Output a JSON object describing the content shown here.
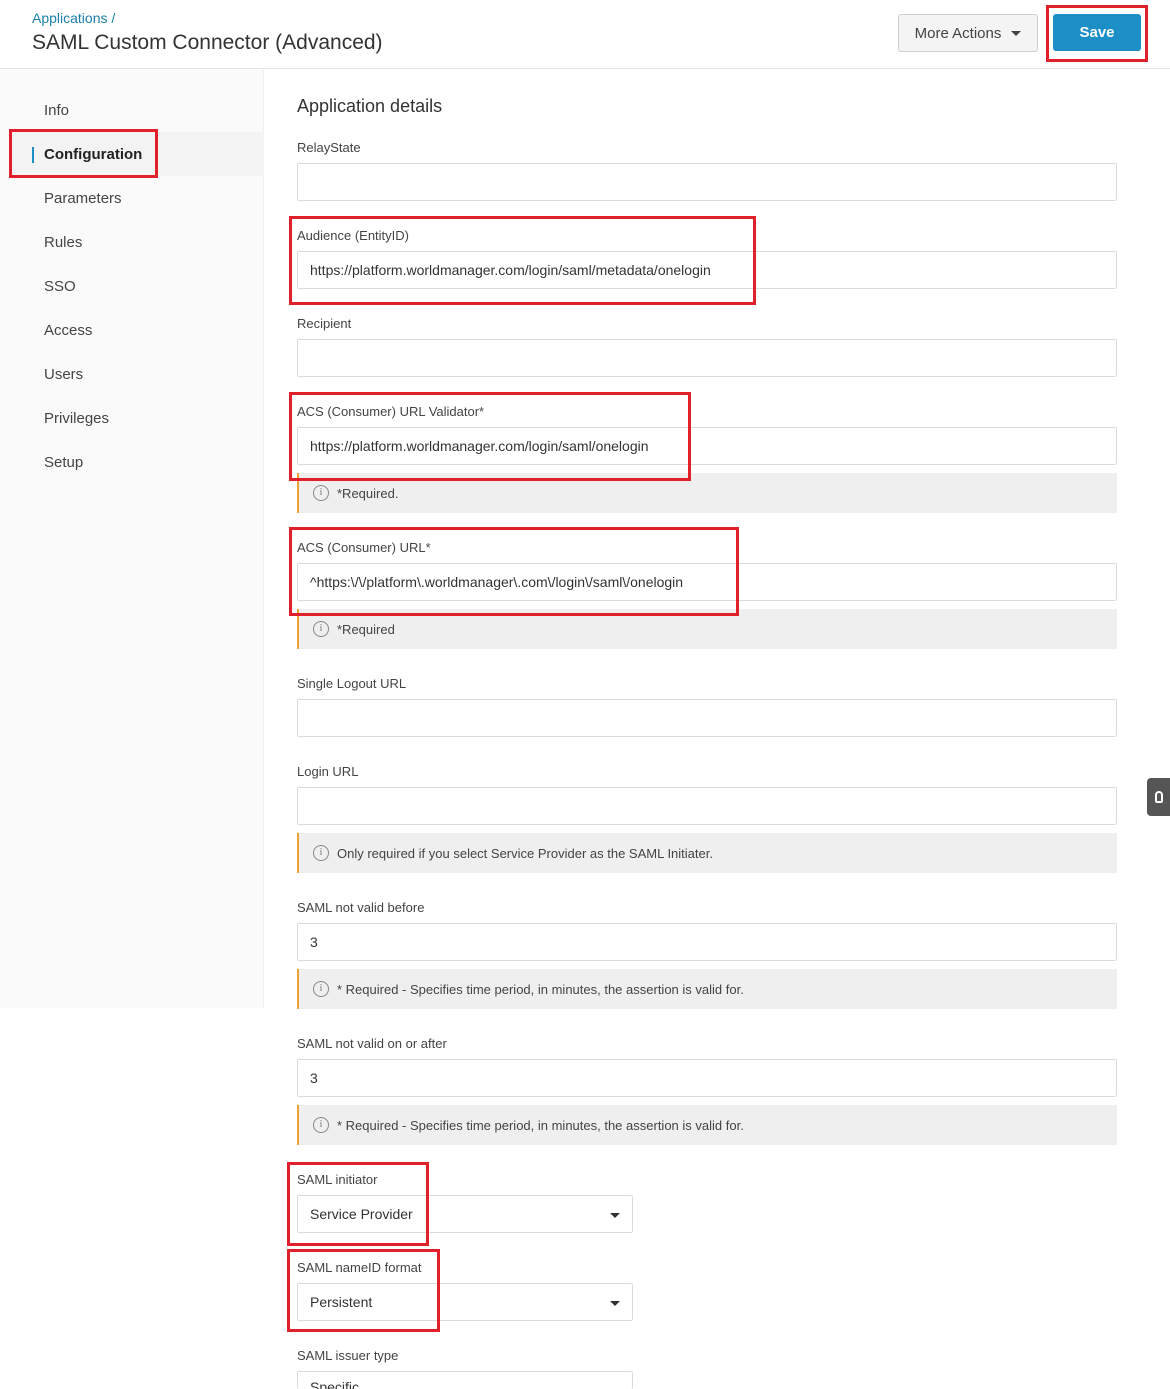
{
  "header": {
    "breadcrumb": "Applications /",
    "title": "SAML Custom Connector (Advanced)",
    "more_actions": "More Actions",
    "save": "Save"
  },
  "sidebar": {
    "items": [
      {
        "label": "Info"
      },
      {
        "label": "Configuration",
        "active": true
      },
      {
        "label": "Parameters"
      },
      {
        "label": "Rules"
      },
      {
        "label": "SSO"
      },
      {
        "label": "Access"
      },
      {
        "label": "Users"
      },
      {
        "label": "Privileges"
      },
      {
        "label": "Setup"
      }
    ]
  },
  "main": {
    "section_title": "Application details",
    "relaystate": {
      "label": "RelayState",
      "value": ""
    },
    "audience": {
      "label": "Audience (EntityID)",
      "value": "https://platform.worldmanager.com/login/saml/metadata/onelogin"
    },
    "recipient": {
      "label": "Recipient",
      "value": ""
    },
    "acs_validator": {
      "label": "ACS (Consumer) URL Validator*",
      "value": "https://platform.worldmanager.com/login/saml/onelogin",
      "note": "*Required."
    },
    "acs_url": {
      "label": "ACS (Consumer) URL*",
      "value": "^https:\\/\\/platform\\.worldmanager\\.com\\/login\\/saml\\/onelogin",
      "note": "*Required"
    },
    "single_logout": {
      "label": "Single Logout URL",
      "value": ""
    },
    "login_url": {
      "label": "Login URL",
      "value": "",
      "note": "Only required if you select Service Provider as the SAML Initiater."
    },
    "not_before": {
      "label": "SAML not valid before",
      "value": "3",
      "note": "* Required - Specifies time period, in minutes, the assertion is valid for."
    },
    "not_after": {
      "label": "SAML not valid on or after",
      "value": "3",
      "note": "* Required - Specifies time period, in minutes, the assertion is valid for."
    },
    "initiator": {
      "label": "SAML initiator",
      "value": "Service Provider"
    },
    "nameid": {
      "label": "SAML nameID format",
      "value": "Persistent"
    },
    "issuer_type": {
      "label": "SAML issuer type",
      "value": "Specific"
    }
  },
  "colors": {
    "accent": "#1b8fc6",
    "highlight": "#e0202a",
    "note_border": "#f0a030"
  }
}
